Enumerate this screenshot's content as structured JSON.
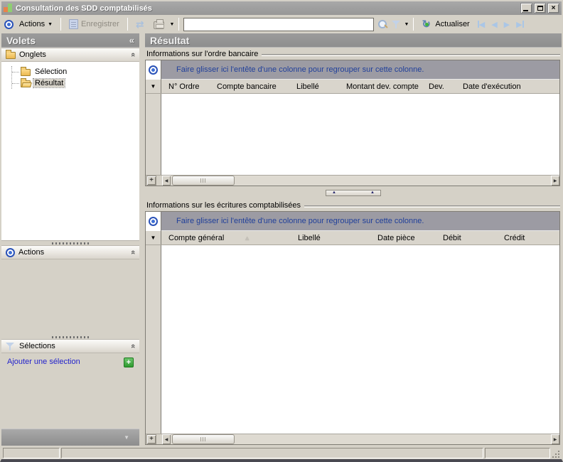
{
  "window": {
    "title": "Consultation des SDD comptabilisés"
  },
  "toolbar": {
    "actions_label": "Actions",
    "save_label": "Enregistrer",
    "refresh_label": "Actualiser",
    "search_value": ""
  },
  "sidebar": {
    "title": "Volets",
    "sections": {
      "onglets": "Onglets",
      "actions": "Actions",
      "selections": "Sélections"
    },
    "tree": {
      "selection": "Sélection",
      "resultat": "Résultat"
    },
    "add_selection_link": "Ajouter une sélection"
  },
  "main": {
    "title": "Résultat",
    "orders": {
      "title": "Informations sur l'ordre bancaire",
      "group_hint": "Faire glisser ici l'entête d'une colonne pour regrouper sur cette colonne.",
      "columns": [
        "N° Ordre",
        "Compte bancaire",
        "Libellé",
        "Montant dev. compte",
        "Dev.",
        "Date d'exécution"
      ],
      "rows": []
    },
    "entries": {
      "title": "Informations sur les écritures comptabilisées",
      "group_hint": "Faire glisser ici l'entête d'une colonne pour regrouper sur cette colonne.",
      "columns": [
        "Compte général",
        "Libellé",
        "Date pièce",
        "Débit",
        "Crédit"
      ],
      "rows": []
    }
  },
  "status": {
    "left": "",
    "center": "",
    "right": ""
  },
  "glyphs": {
    "dropdown": "▼",
    "collapse": "«",
    "chevron_up": "«",
    "sort_asc": "▲",
    "splitter": "▲",
    "prev": "◀",
    "next": "▶",
    "plus": "+",
    "close": "×",
    "refresh": "↻",
    "sync": "⇄",
    "indicator": "▼"
  },
  "colors": {
    "accent_blue": "#2a52b8",
    "group_hint_blue": "#21409a",
    "link_blue": "#2323cc",
    "add_button_green": "#2f9a2f",
    "chrome_gray": "#d5d1c7",
    "header_gray": "#949494"
  }
}
